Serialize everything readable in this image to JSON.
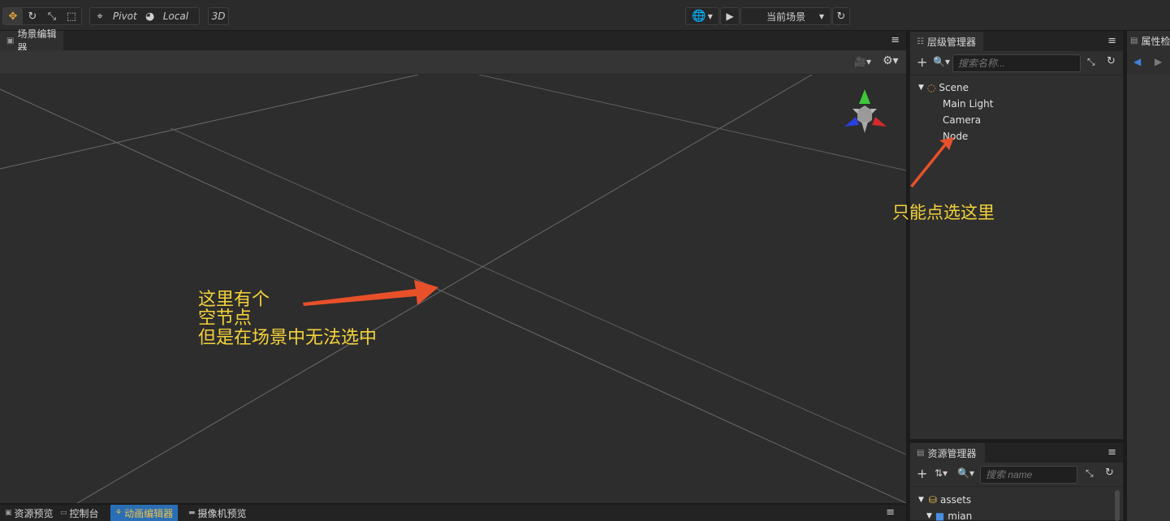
{
  "toolbar": {
    "pivot_label": "Pivot",
    "local_label": "Local",
    "mode_3d": "3D",
    "scene_select": "当前场景"
  },
  "scene_panel": {
    "tab_label": "场景编辑器"
  },
  "hierarchy": {
    "tab_label": "层级管理器",
    "search_placeholder": "搜索名称...",
    "tree": {
      "root": "Scene",
      "children": [
        "Main Light",
        "Camera",
        "Node"
      ]
    }
  },
  "assets": {
    "tab_label": "资源管理器",
    "search_placeholder": "搜索 name",
    "tree": [
      "assets",
      "mian"
    ]
  },
  "properties": {
    "tab_label": "属性检"
  },
  "bottom_tabs": [
    "资源预览",
    "控制台",
    "动画编辑器",
    "摄像机预览"
  ],
  "annotations": {
    "scene_line1": "这里有个",
    "scene_line2": "空节点",
    "scene_line3": "但是在场景中无法选中",
    "hier_note": "只能点选这里"
  },
  "colors": {
    "annotation_text": "#f3d23a",
    "annotation_arrow": "#e8502a",
    "active_tab": "#2a6fb5",
    "accent": "#e8a33d"
  }
}
